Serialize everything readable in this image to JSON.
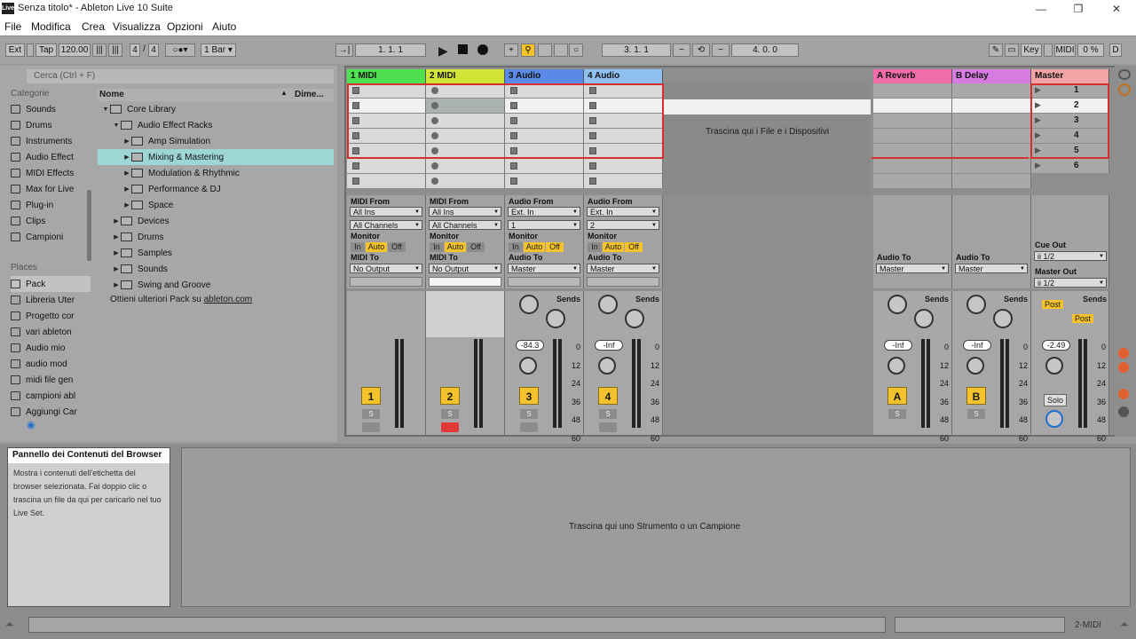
{
  "window": {
    "title": "Senza titolo* - Ableton Live 10 Suite",
    "app_icon": "Live"
  },
  "menu": [
    "File",
    "Modifica",
    "Crea",
    "Visualizza",
    "Opzioni",
    "Aiuto"
  ],
  "control": {
    "ext": "Ext",
    "tap": "Tap",
    "tempo": "120.00",
    "sig_num": "4",
    "sig_den": "4",
    "quant": "1 Bar",
    "pos": "1.   1.   1",
    "loop_start": "3.   1.   1",
    "loop_len": "4.   0.   0",
    "key": "Key",
    "midi": "MIDI",
    "cpu": "0 %",
    "d": "D"
  },
  "browser": {
    "search_placeholder": "Cerca (Ctrl + F)",
    "categories_title": "Categorie",
    "categories": [
      "Sounds",
      "Drums",
      "Instruments",
      "Audio Effect",
      "MIDI Effects",
      "Max for Live",
      "Plug-in",
      "Clips",
      "Campioni"
    ],
    "places_title": "Places",
    "places": [
      "Pack",
      "Libreria Uter",
      "Progetto cor",
      "vari ableton",
      "Audio mio",
      "audio mod",
      "midi file gen",
      "campioni abl",
      "Aggiungi Car"
    ],
    "col_name": "Nome",
    "col_dim": "Dime...",
    "tree": [
      {
        "label": "Core Library",
        "level": 0,
        "arrow": "▼"
      },
      {
        "label": "Audio Effect Racks",
        "level": 1,
        "arrow": "▼"
      },
      {
        "label": "Amp Simulation",
        "level": 2,
        "arrow": "▶"
      },
      {
        "label": "Mixing & Mastering",
        "level": 2,
        "arrow": "▶",
        "selected": true
      },
      {
        "label": "Modulation & Rhythmic",
        "level": 2,
        "arrow": "▶"
      },
      {
        "label": "Performance & DJ",
        "level": 2,
        "arrow": "▶"
      },
      {
        "label": "Space",
        "level": 2,
        "arrow": "▶"
      },
      {
        "label": "Devices",
        "level": 1,
        "arrow": "▶"
      },
      {
        "label": "Drums",
        "level": 1,
        "arrow": "▶"
      },
      {
        "label": "Samples",
        "level": 1,
        "arrow": "▶"
      },
      {
        "label": "Sounds",
        "level": 1,
        "arrow": "▶"
      },
      {
        "label": "Swing and Groove",
        "level": 1,
        "arrow": "▶"
      }
    ],
    "pack_hint": "Ottieni ulteriori Pack su",
    "pack_link": "ableton.com"
  },
  "session": {
    "tracks": [
      {
        "name": "1 MIDI",
        "color": "#4ee04e",
        "type": "midi",
        "from_label": "MIDI From",
        "from": "All Ins",
        "channel": "All Channels",
        "to_label": "MIDI To",
        "to": "No Output",
        "num": "1"
      },
      {
        "name": "2 MIDI",
        "color": "#d2e536",
        "type": "midi",
        "from_label": "MIDI From",
        "from": "All Ins",
        "channel": "All Channels",
        "to_label": "MIDI To",
        "to": "No Output",
        "num": "2"
      },
      {
        "name": "3 Audio",
        "color": "#5a8ae6",
        "type": "audio",
        "from_label": "Audio From",
        "from": "Ext. In",
        "channel": "1",
        "to_label": "Audio To",
        "to": "Master",
        "num": "3",
        "vol": "-84.3"
      },
      {
        "name": "4 Audio",
        "color": "#8fc0f0",
        "type": "audio",
        "from_label": "Audio From",
        "from": "Ext. In",
        "channel": "2",
        "to_label": "Audio To",
        "to": "Master",
        "num": "4",
        "vol": "-Inf"
      }
    ],
    "returns": [
      {
        "name": "A Reverb",
        "color": "#ef6eaa",
        "to_label": "Audio To",
        "to": "Master",
        "num": "A",
        "vol": "-Inf"
      },
      {
        "name": "B Delay",
        "color": "#d67be0",
        "to_label": "Audio To",
        "to": "Master",
        "num": "B",
        "vol": "-Inf"
      }
    ],
    "master": {
      "name": "Master",
      "color": "#f3a5a5",
      "scenes": [
        "1",
        "2",
        "3",
        "4",
        "5",
        "6"
      ],
      "cue_label": "Cue Out",
      "cue": "ii 1/2",
      "out_label": "Master Out",
      "out": "ii 1/2",
      "vol": "-2.49",
      "solo": "Solo",
      "post": "Post"
    },
    "drop_hint": "Trascina qui i File e i Dispositivi",
    "monitor_label": "Monitor",
    "monitor": [
      "In",
      "Auto",
      "Off"
    ],
    "sends": "Sends",
    "scale": [
      "0",
      "12",
      "24",
      "36",
      "48",
      "60"
    ],
    "s_label": "S"
  },
  "detail": {
    "info_title": "Pannello dei Contenuti del Browser",
    "info_text": "Mostra i contenuti dell'etichetta del browser selezionata. Fai doppio clic o trascina un file da qui per caricarlo nel tuo Live Set.",
    "drop_hint": "Trascina qui uno Strumento o un Campione"
  },
  "status": {
    "track": "2-MIDI"
  }
}
